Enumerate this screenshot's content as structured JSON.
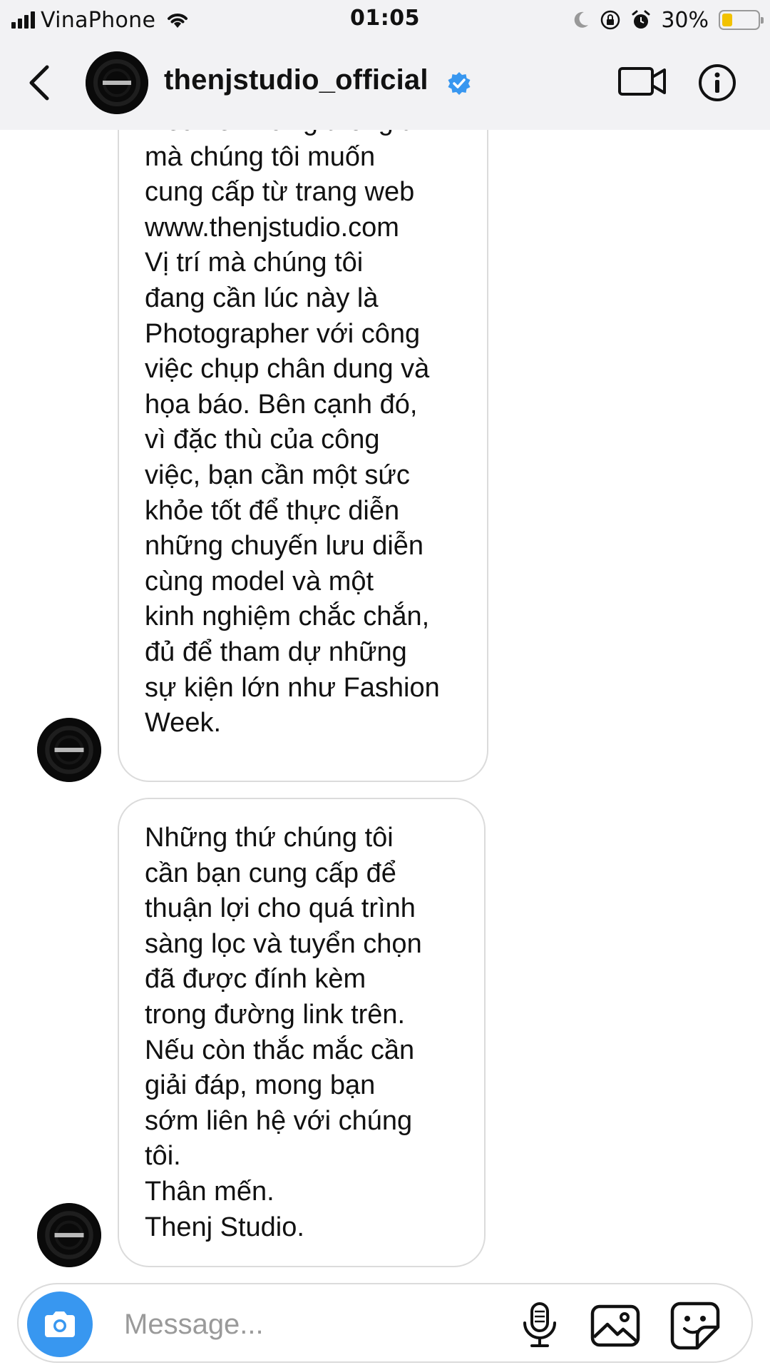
{
  "status_bar": {
    "carrier": "VinaPhone",
    "time": "01:05",
    "battery_percent": "30%",
    "battery_level": 0.3,
    "icons": [
      "signal-icon",
      "wifi-icon",
      "moon-icon",
      "orientation-lock-icon",
      "alarm-icon",
      "battery-icon"
    ]
  },
  "header": {
    "title": "thenjstudio_official",
    "verified": true,
    "icons": [
      "back-chevron-icon",
      "verified-badge-icon",
      "video-call-icon",
      "info-icon"
    ]
  },
  "messages": [
    {
      "sender": "thenjstudio_official",
      "text": "hiểu về những thông tin\nmà chúng tôi muốn\ncung cấp từ trang web\nwww.thenjstudio.com\nVị trí mà chúng tôi\nđang cần lúc này là\nPhotographer với công\nviệc chụp chân dung và\nhọa báo. Bên cạnh đó,\nvì đặc thù của công\nviệc, bạn cần một sức\nkhỏe tốt để thực diễn\nnhững chuyến lưu diễn\ncùng model và một\nkinh nghiệm chắc chắn,\nđủ để tham dự những\nsự kiện lớn như Fashion\nWeek."
    },
    {
      "sender": "thenjstudio_official",
      "text": "Những thứ chúng tôi\ncần bạn cung cấp để\nthuận lợi cho quá trình\nsàng lọc và tuyển chọn\nđã được đính kèm\ntrong đường link trên.\nNếu còn thắc mắc cần\ngiải đáp, mong bạn\nsớm liên hệ với chúng\ntôi.\nThân mến.\nThenj Studio."
    }
  ],
  "composer": {
    "placeholder": "Message...",
    "value": "",
    "icons": [
      "camera-icon",
      "microphone-icon",
      "gallery-icon",
      "sticker-icon"
    ]
  },
  "colors": {
    "accent": "#3897f0",
    "bar_background": "#f2f2f4",
    "bubble_border": "#dbdbdb",
    "battery_fill": "#f2c200"
  }
}
